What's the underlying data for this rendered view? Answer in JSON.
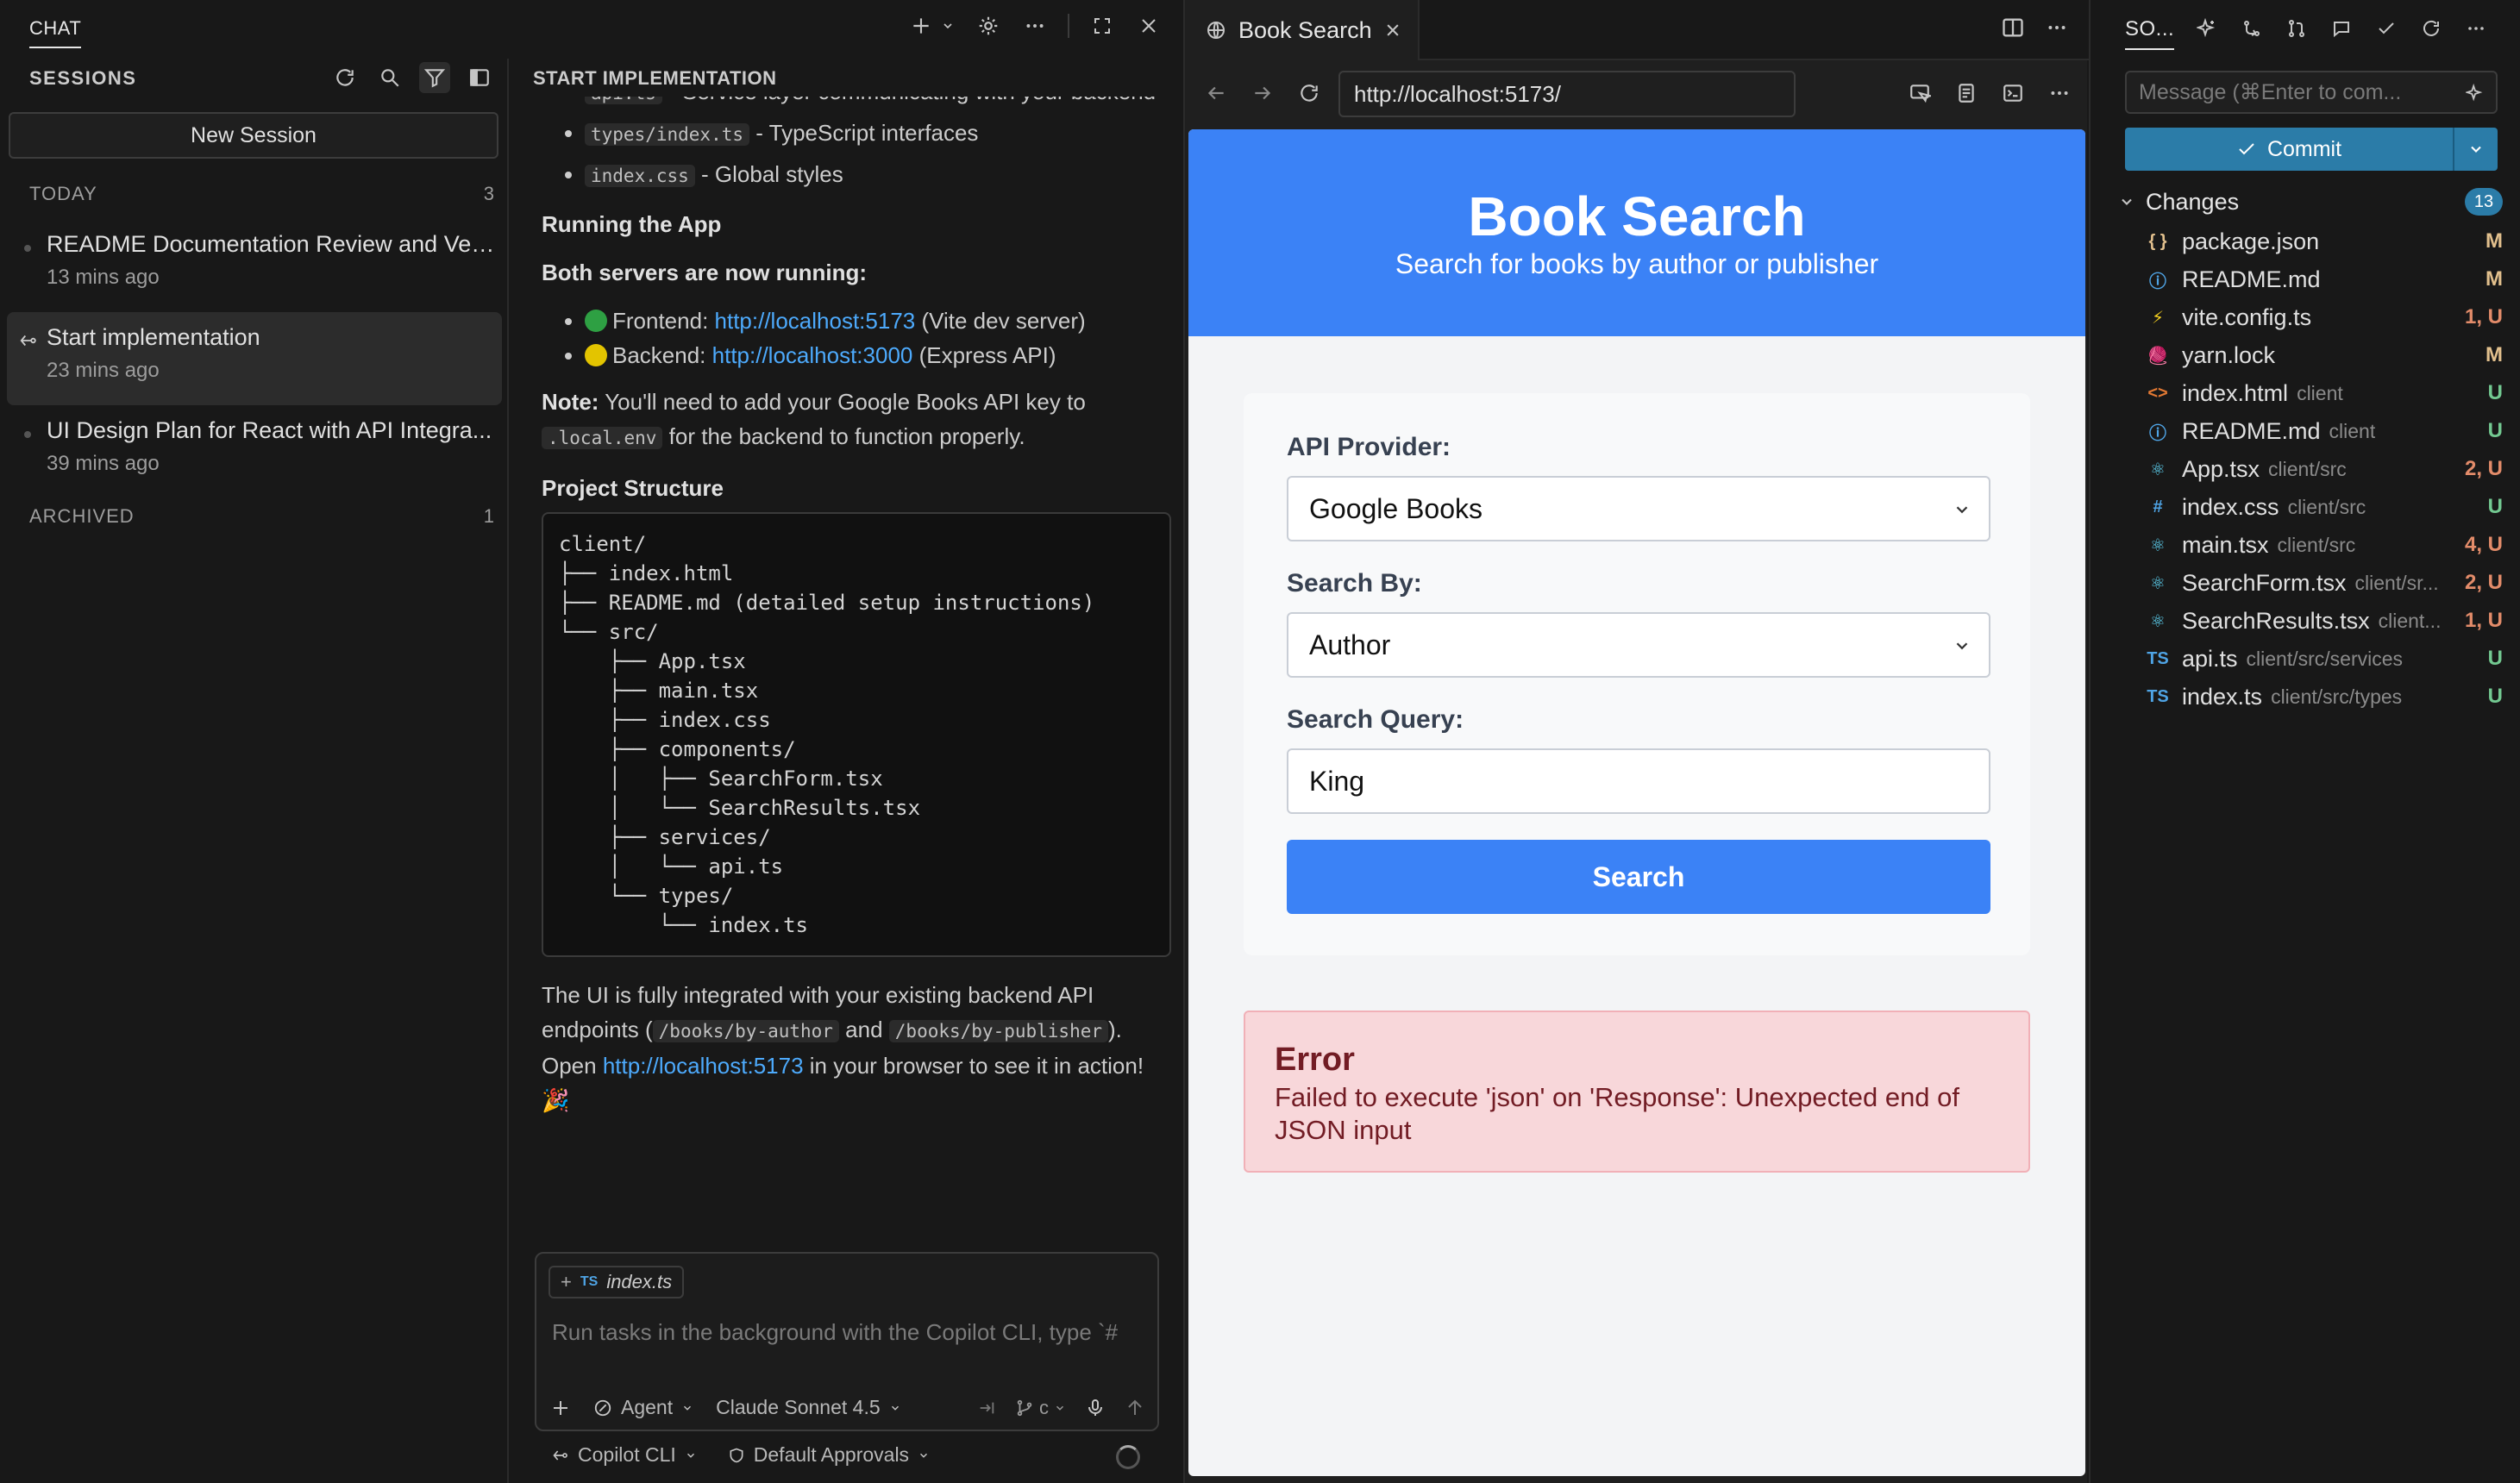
{
  "chat": {
    "tab_label": "CHAT",
    "sessions_header": "SESSIONS",
    "new_session_label": "New Session",
    "groups": {
      "today": {
        "label": "TODAY",
        "count": "3"
      },
      "archived": {
        "label": "ARCHIVED",
        "count": "1"
      }
    },
    "sessions": [
      {
        "title": "README Documentation Review and Ver...",
        "time": "13 mins ago"
      },
      {
        "title": "Start implementation",
        "time": "23 mins ago"
      },
      {
        "title": "UI Design Plan for React with API Integra...",
        "time": "39 mins ago"
      }
    ],
    "conversation": {
      "heading": "START IMPLEMENTATION",
      "top_partial": {
        "code": "api.ts",
        "text": "- Service layer communicating with your backend"
      },
      "bullets_top": [
        {
          "code": "types/index.ts",
          "text": " - TypeScript interfaces"
        },
        {
          "code": "index.css",
          "text": " - Global styles"
        }
      ],
      "running_heading": "Running the App",
      "servers_heading": "Both servers are now running:",
      "servers": [
        {
          "label": "Frontend: ",
          "url": "http://localhost:5173",
          "suffix": " (Vite dev server)",
          "color": "#2ea043"
        },
        {
          "label": "Backend: ",
          "url": "http://localhost:3000",
          "suffix": " (Express API)",
          "color": "#e3c400"
        }
      ],
      "note_label": "Note:",
      "note_text": " You'll need to add your Google Books API key to ",
      "note_code": ".local.env",
      "note_tail": " for the backend to function properly.",
      "structure_heading": "Project Structure",
      "tree": "client/\n├── index.html\n├── README.md (detailed setup instructions)\n└── src/\n    ├── App.tsx\n    ├── main.tsx\n    ├── index.css\n    ├── components/\n    │   ├── SearchForm.tsx\n    │   └── SearchResults.tsx\n    ├── services/\n    │   └── api.ts\n    └── types/\n        └── index.ts",
      "closing_1": "The UI is fully integrated with your existing backend API endpoints (",
      "closing_code1": "/books/by-author",
      "closing_and": " and ",
      "closing_code2": "/books/by-publisher",
      "closing_2": "). Open ",
      "closing_link": "http://localhost:5173",
      "closing_3": " in your browser to see it in action! 🎉"
    },
    "composer": {
      "context_chip": "index.ts",
      "context_chip_type": "TS",
      "placeholder": "Run tasks in the background with the Copilot CLI, type `#",
      "mode": "Agent",
      "model": "Claude Sonnet 4.5",
      "branch_label": "c",
      "status_cli": "Copilot CLI",
      "status_approvals": "Default Approvals"
    }
  },
  "browser": {
    "tab_title": "Book Search",
    "url": "http://localhost:5173/",
    "page": {
      "title": "Book Search",
      "subtitle": "Search for books by author or publisher",
      "api_label": "API Provider:",
      "api_value": "Google Books",
      "search_by_label": "Search By:",
      "search_by_value": "Author",
      "query_label": "Search Query:",
      "query_value": "King",
      "search_button": "Search",
      "error_title": "Error",
      "error_message": "Failed to execute 'json' on 'Response': Unexpected end of JSON input",
      "colors": {
        "header": "#3b82f6",
        "button": "#3b82f6",
        "error_bg": "#f8d7da",
        "error_text": "#721c24"
      }
    }
  },
  "scm": {
    "title": "SO...",
    "message_placeholder": "Message (⌘Enter to com...",
    "commit_label": "Commit",
    "changes_label": "Changes",
    "changes_count": "13",
    "files": [
      {
        "icon": "{ }",
        "name": "package.json",
        "path": "",
        "status": "M",
        "icon_color": "#e2c08d"
      },
      {
        "icon": "ⓘ",
        "name": "README.md",
        "path": "",
        "status": "M",
        "icon_color": "#4fa4e5"
      },
      {
        "icon": "⚡",
        "name": "vite.config.ts",
        "path": "",
        "status": "1, U",
        "icon_color": "#f5d020"
      },
      {
        "icon": "🧶",
        "name": "yarn.lock",
        "path": "",
        "status": "M",
        "icon_color": "#4fa4e5"
      },
      {
        "icon": "<>",
        "name": "index.html",
        "path": "client",
        "status": "U",
        "icon_color": "#e37933"
      },
      {
        "icon": "ⓘ",
        "name": "README.md",
        "path": "client",
        "status": "U",
        "icon_color": "#4fa4e5"
      },
      {
        "icon": "⚛",
        "name": "App.tsx",
        "path": "client/src",
        "status": "2, U",
        "icon_color": "#61dafb"
      },
      {
        "icon": "#",
        "name": "index.css",
        "path": "client/src",
        "status": "U",
        "icon_color": "#4fa4e5"
      },
      {
        "icon": "⚛",
        "name": "main.tsx",
        "path": "client/src",
        "status": "4, U",
        "icon_color": "#61dafb"
      },
      {
        "icon": "⚛",
        "name": "SearchForm.tsx",
        "path": "client/sr...",
        "status": "2, U",
        "icon_color": "#61dafb"
      },
      {
        "icon": "⚛",
        "name": "SearchResults.tsx",
        "path": "client...",
        "status": "1, U",
        "icon_color": "#61dafb"
      },
      {
        "icon": "TS",
        "name": "api.ts",
        "path": "client/src/services",
        "status": "U",
        "icon_color": "#4fa4e5"
      },
      {
        "icon": "TS",
        "name": "index.ts",
        "path": "client/src/types",
        "status": "U",
        "icon_color": "#4fa4e5"
      }
    ]
  }
}
